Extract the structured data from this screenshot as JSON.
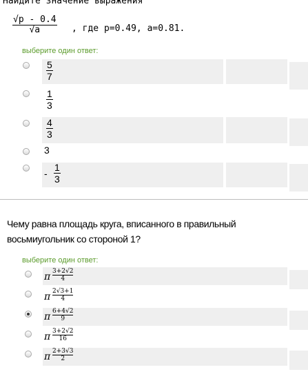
{
  "q1": {
    "title": "Найдите значение выражения",
    "expr_num": "√p - 0.4",
    "expr_den": "√a",
    "expr_tail": ", где p=0.49, a=0.81.",
    "hint": "выберите один ответ:",
    "options": [
      {
        "num": "5",
        "den": "7",
        "checked": false
      },
      {
        "num": "1",
        "den": "3",
        "checked": false
      },
      {
        "num": "4",
        "den": "3",
        "checked": false
      },
      {
        "plain": "3",
        "checked": false
      },
      {
        "sign": "-",
        "num": "1",
        "den": "3",
        "checked": false
      }
    ]
  },
  "q2": {
    "question": "Чему равна площадь круга, вписанного в правильный восьмиугольник со стороной 1?",
    "hint": "выберите один ответ:",
    "pi": "π",
    "options": [
      {
        "num": "3+2√2",
        "den": "4",
        "checked": false
      },
      {
        "num": "2√3+1",
        "den": "4",
        "checked": false
      },
      {
        "num": "6+4√2",
        "den": "9",
        "checked": true
      },
      {
        "num": "3+2√2",
        "den": "16",
        "checked": false
      },
      {
        "num": "2+3√3",
        "den": "2",
        "checked": false
      }
    ]
  },
  "colors": {
    "hint": "#5b9b2b",
    "stripe": "#efefef"
  }
}
